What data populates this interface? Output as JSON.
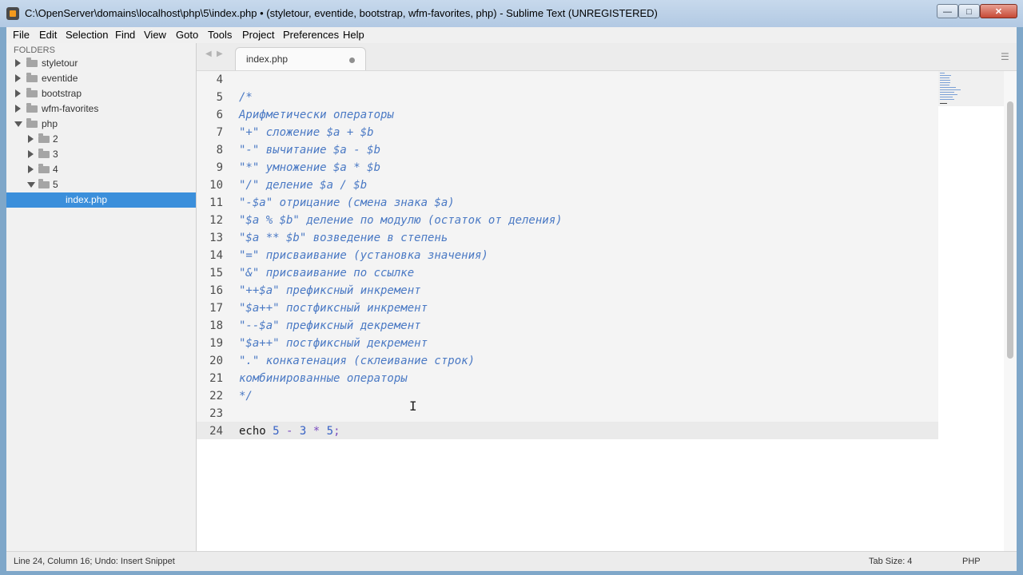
{
  "window": {
    "title": "C:\\OpenServer\\domains\\localhost\\php\\5\\index.php • (styletour, eventide, bootstrap, wfm-favorites, php) - Sublime Text (UNREGISTERED)",
    "min_glyph": "—",
    "max_glyph": "□",
    "close_glyph": "✕"
  },
  "menu": [
    "File",
    "Edit",
    "Selection",
    "Find",
    "View",
    "Goto",
    "Tools",
    "Project",
    "Preferences",
    "Help"
  ],
  "sidebar": {
    "header": "FOLDERS",
    "items": [
      {
        "label": "styletour",
        "type": "folder",
        "expanded": false,
        "depth": 0
      },
      {
        "label": "eventide",
        "type": "folder",
        "expanded": false,
        "depth": 0
      },
      {
        "label": "bootstrap",
        "type": "folder",
        "expanded": false,
        "depth": 0
      },
      {
        "label": "wfm-favorites",
        "type": "folder",
        "expanded": false,
        "depth": 0
      },
      {
        "label": "php",
        "type": "folder",
        "expanded": true,
        "depth": 0
      },
      {
        "label": "2",
        "type": "folder",
        "expanded": false,
        "depth": 1
      },
      {
        "label": "3",
        "type": "folder",
        "expanded": false,
        "depth": 1
      },
      {
        "label": "4",
        "type": "folder",
        "expanded": false,
        "depth": 1
      },
      {
        "label": "5",
        "type": "folder",
        "expanded": true,
        "depth": 1
      },
      {
        "label": "index.php",
        "type": "file",
        "selected": true,
        "depth": 2
      }
    ]
  },
  "tabs": [
    {
      "label": "index.php",
      "dirty": true,
      "active": true
    }
  ],
  "editor": {
    "lines": [
      {
        "n": "4",
        "tokens": []
      },
      {
        "n": "5",
        "tokens": [
          {
            "t": "/*",
            "c": "comment"
          }
        ]
      },
      {
        "n": "6",
        "tokens": [
          {
            "t": "Арифметически операторы",
            "c": "comment"
          }
        ]
      },
      {
        "n": "7",
        "tokens": [
          {
            "t": "\"+\" сложение $a + $b",
            "c": "comment"
          }
        ]
      },
      {
        "n": "8",
        "tokens": [
          {
            "t": "\"-\" вычитание $a - $b",
            "c": "comment"
          }
        ]
      },
      {
        "n": "9",
        "tokens": [
          {
            "t": "\"*\" умножение $a * $b",
            "c": "comment"
          }
        ]
      },
      {
        "n": "10",
        "tokens": [
          {
            "t": "\"/\" деление $a / $b",
            "c": "comment"
          }
        ]
      },
      {
        "n": "11",
        "tokens": [
          {
            "t": "\"-$a\" отрицание (смена знака $a)",
            "c": "comment"
          }
        ]
      },
      {
        "n": "12",
        "tokens": [
          {
            "t": "\"$a % $b\" деление по модулю (остаток от деления)",
            "c": "comment"
          }
        ]
      },
      {
        "n": "13",
        "tokens": [
          {
            "t": "\"$a ** $b\" возведение в степень",
            "c": "comment"
          }
        ]
      },
      {
        "n": "14",
        "tokens": [
          {
            "t": "\"=\" присваивание (установка значения)",
            "c": "comment"
          }
        ]
      },
      {
        "n": "15",
        "tokens": [
          {
            "t": "\"&\" присваивание по ссылке",
            "c": "comment"
          }
        ]
      },
      {
        "n": "16",
        "tokens": [
          {
            "t": "\"++$a\" префиксный инкремент",
            "c": "comment"
          }
        ]
      },
      {
        "n": "17",
        "tokens": [
          {
            "t": "\"$a++\" постфиксный инкремент",
            "c": "comment"
          }
        ]
      },
      {
        "n": "18",
        "tokens": [
          {
            "t": "\"--$a\" префиксный декремент",
            "c": "comment"
          }
        ]
      },
      {
        "n": "19",
        "tokens": [
          {
            "t": "\"$a++\" постфиксный декремент",
            "c": "comment"
          }
        ]
      },
      {
        "n": "20",
        "tokens": [
          {
            "t": "\".\" конкатенация (склеивание строк)",
            "c": "comment"
          }
        ]
      },
      {
        "n": "21",
        "tokens": [
          {
            "t": "комбинированные операторы",
            "c": "comment"
          }
        ]
      },
      {
        "n": "22",
        "tokens": [
          {
            "t": "*/",
            "c": "comment"
          }
        ]
      },
      {
        "n": "23",
        "tokens": []
      },
      {
        "n": "24",
        "tokens": [
          {
            "t": "echo",
            "c": "kw"
          },
          {
            "t": " ",
            "c": "kw"
          },
          {
            "t": "5",
            "c": "num"
          },
          {
            "t": " ",
            "c": "kw"
          },
          {
            "t": "-",
            "c": "op"
          },
          {
            "t": " ",
            "c": "kw"
          },
          {
            "t": "3",
            "c": "num"
          },
          {
            "t": " ",
            "c": "kw"
          },
          {
            "t": "*",
            "c": "op"
          },
          {
            "t": " ",
            "c": "kw"
          },
          {
            "t": "5",
            "c": "num"
          },
          {
            "t": ";",
            "c": "punct"
          }
        ]
      }
    ],
    "current_line": "24",
    "mouse_cursor_glyph": "I"
  },
  "statusbar": {
    "left": "Line 24, Column 16; Undo: Insert Snippet",
    "tab_size": "Tab Size: 4",
    "syntax": "PHP"
  },
  "icons": {
    "tab_nav_left": "◀",
    "tab_nav_right": "▶",
    "tab_overflow": "☰"
  }
}
